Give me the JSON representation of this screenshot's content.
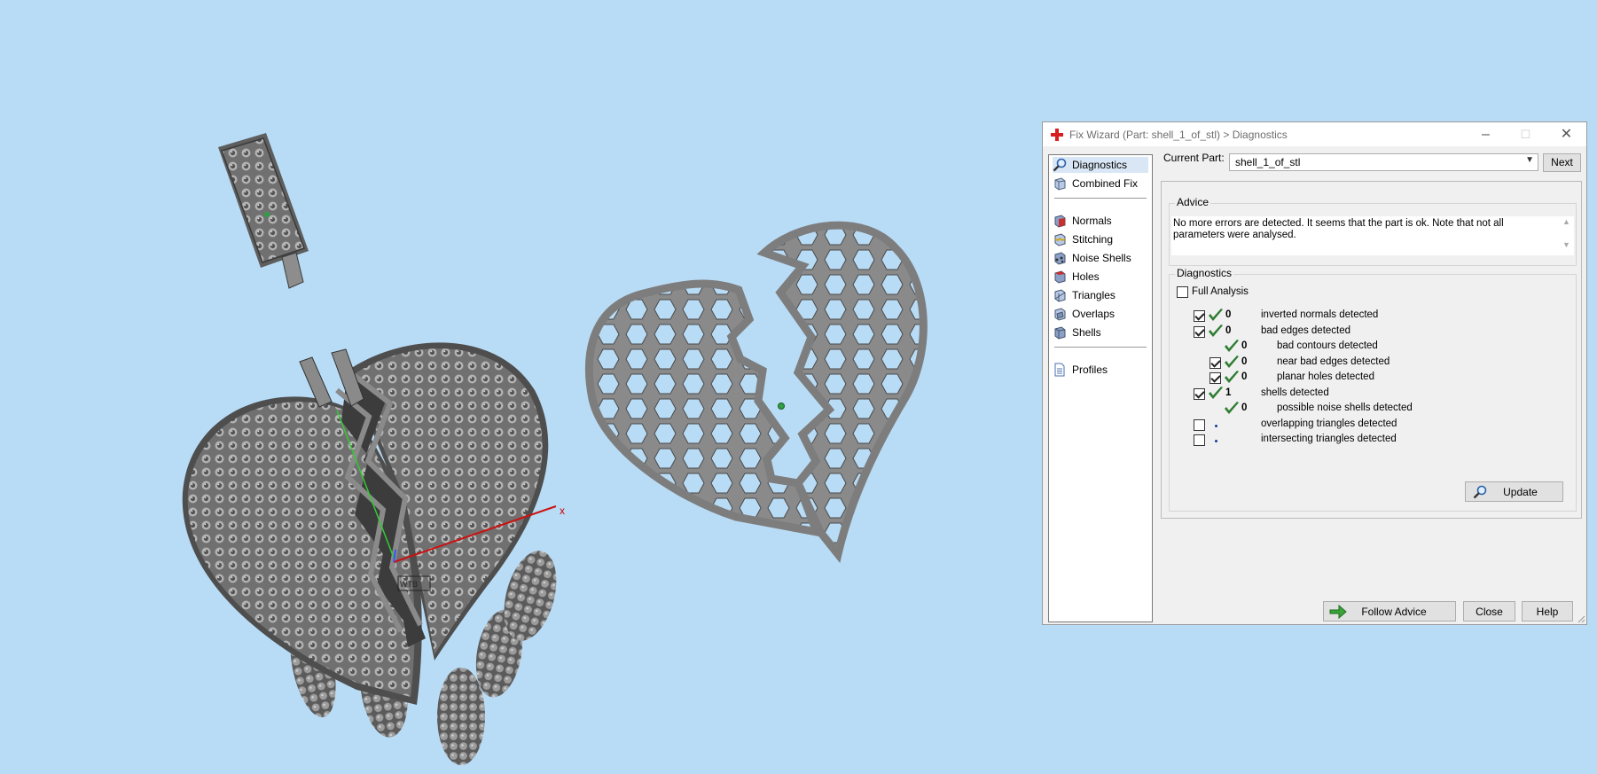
{
  "viewport": {
    "axis_x_label": "x",
    "box_label": "WTB"
  },
  "dialog": {
    "title": "Fix Wizard (Part: shell_1_of_stl) > Diagnostics",
    "window_buttons": {
      "minimize": "–",
      "maximize": "☐",
      "close": "✕"
    },
    "nav": [
      {
        "label": "Diagnostics",
        "icon": "magnifier-icon",
        "selected": true
      },
      {
        "label": "Combined Fix",
        "icon": "cube-icon"
      },
      {
        "label": "Normals",
        "icon": "normals-cube-icon"
      },
      {
        "label": "Stitching",
        "icon": "stitching-cube-icon"
      },
      {
        "label": "Noise Shells",
        "icon": "noise-shells-icon"
      },
      {
        "label": "Holes",
        "icon": "holes-cube-icon"
      },
      {
        "label": "Triangles",
        "icon": "triangles-cube-icon"
      },
      {
        "label": "Overlaps",
        "icon": "overlaps-cube-icon"
      },
      {
        "label": "Shells",
        "icon": "shells-cube-icon"
      },
      {
        "label": "Profiles",
        "icon": "document-icon"
      }
    ],
    "current_part_label": "Current Part:",
    "current_part_value": "shell_1_of_stl",
    "next_label": "Next",
    "advice_title": "Advice",
    "advice_text": "No more errors are detected. It seems that the part is ok. Note that not all parameters were analysed.",
    "diagnostics_title": "Diagnostics",
    "full_analysis_label": "Full Analysis",
    "full_analysis_checked": false,
    "rows": [
      {
        "checkbox": true,
        "checked": true,
        "status": "ok",
        "count": "0",
        "label": "inverted normals detected",
        "indent": 0
      },
      {
        "checkbox": true,
        "checked": true,
        "status": "ok",
        "count": "0",
        "label": "bad edges detected",
        "indent": 0
      },
      {
        "checkbox": false,
        "checked": false,
        "status": "ok",
        "count": "0",
        "label": "bad contours detected",
        "indent": 1
      },
      {
        "checkbox": true,
        "checked": true,
        "status": "ok",
        "count": "0",
        "label": "near bad edges detected",
        "indent": 1
      },
      {
        "checkbox": true,
        "checked": true,
        "status": "ok",
        "count": "0",
        "label": "planar holes detected",
        "indent": 1
      },
      {
        "checkbox": true,
        "checked": true,
        "status": "ok",
        "count": "1",
        "label": "shells detected",
        "indent": 0
      },
      {
        "checkbox": false,
        "checked": false,
        "status": "ok",
        "count": "0",
        "label": "possible noise shells detected",
        "indent": 1
      },
      {
        "checkbox": true,
        "checked": false,
        "status": "none",
        "count": "",
        "label": "overlapping triangles detected",
        "indent": 0
      },
      {
        "checkbox": true,
        "checked": false,
        "status": "none",
        "count": "",
        "label": "intersecting triangles detected",
        "indent": 0
      }
    ],
    "update_label": "Update",
    "follow_advice_label": "Follow Advice",
    "close_label": "Close",
    "help_label": "Help",
    "colors": {
      "check_green": "#2e7d32",
      "background": "#b9dcf6",
      "mesh_gray": "#7b7b7b"
    }
  }
}
